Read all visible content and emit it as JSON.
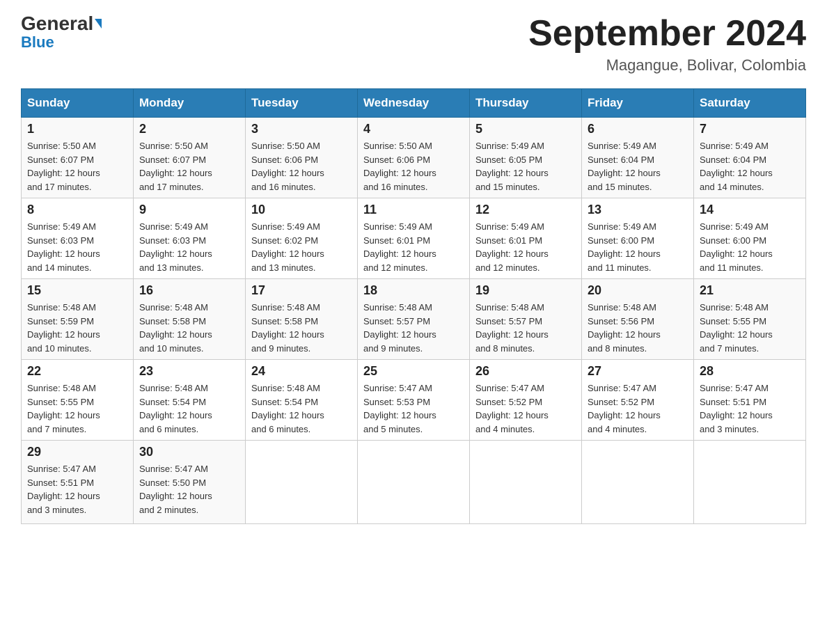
{
  "logo": {
    "text_general": "General",
    "text_blue": "Blue"
  },
  "header": {
    "title": "September 2024",
    "subtitle": "Magangue, Bolivar, Colombia"
  },
  "days_of_week": [
    "Sunday",
    "Monday",
    "Tuesday",
    "Wednesday",
    "Thursday",
    "Friday",
    "Saturday"
  ],
  "weeks": [
    [
      {
        "num": "1",
        "sunrise": "5:50 AM",
        "sunset": "6:07 PM",
        "daylight": "12 hours and 17 minutes."
      },
      {
        "num": "2",
        "sunrise": "5:50 AM",
        "sunset": "6:07 PM",
        "daylight": "12 hours and 17 minutes."
      },
      {
        "num": "3",
        "sunrise": "5:50 AM",
        "sunset": "6:06 PM",
        "daylight": "12 hours and 16 minutes."
      },
      {
        "num": "4",
        "sunrise": "5:50 AM",
        "sunset": "6:06 PM",
        "daylight": "12 hours and 16 minutes."
      },
      {
        "num": "5",
        "sunrise": "5:49 AM",
        "sunset": "6:05 PM",
        "daylight": "12 hours and 15 minutes."
      },
      {
        "num": "6",
        "sunrise": "5:49 AM",
        "sunset": "6:04 PM",
        "daylight": "12 hours and 15 minutes."
      },
      {
        "num": "7",
        "sunrise": "5:49 AM",
        "sunset": "6:04 PM",
        "daylight": "12 hours and 14 minutes."
      }
    ],
    [
      {
        "num": "8",
        "sunrise": "5:49 AM",
        "sunset": "6:03 PM",
        "daylight": "12 hours and 14 minutes."
      },
      {
        "num": "9",
        "sunrise": "5:49 AM",
        "sunset": "6:03 PM",
        "daylight": "12 hours and 13 minutes."
      },
      {
        "num": "10",
        "sunrise": "5:49 AM",
        "sunset": "6:02 PM",
        "daylight": "12 hours and 13 minutes."
      },
      {
        "num": "11",
        "sunrise": "5:49 AM",
        "sunset": "6:01 PM",
        "daylight": "12 hours and 12 minutes."
      },
      {
        "num": "12",
        "sunrise": "5:49 AM",
        "sunset": "6:01 PM",
        "daylight": "12 hours and 12 minutes."
      },
      {
        "num": "13",
        "sunrise": "5:49 AM",
        "sunset": "6:00 PM",
        "daylight": "12 hours and 11 minutes."
      },
      {
        "num": "14",
        "sunrise": "5:49 AM",
        "sunset": "6:00 PM",
        "daylight": "12 hours and 11 minutes."
      }
    ],
    [
      {
        "num": "15",
        "sunrise": "5:48 AM",
        "sunset": "5:59 PM",
        "daylight": "12 hours and 10 minutes."
      },
      {
        "num": "16",
        "sunrise": "5:48 AM",
        "sunset": "5:58 PM",
        "daylight": "12 hours and 10 minutes."
      },
      {
        "num": "17",
        "sunrise": "5:48 AM",
        "sunset": "5:58 PM",
        "daylight": "12 hours and 9 minutes."
      },
      {
        "num": "18",
        "sunrise": "5:48 AM",
        "sunset": "5:57 PM",
        "daylight": "12 hours and 9 minutes."
      },
      {
        "num": "19",
        "sunrise": "5:48 AM",
        "sunset": "5:57 PM",
        "daylight": "12 hours and 8 minutes."
      },
      {
        "num": "20",
        "sunrise": "5:48 AM",
        "sunset": "5:56 PM",
        "daylight": "12 hours and 8 minutes."
      },
      {
        "num": "21",
        "sunrise": "5:48 AM",
        "sunset": "5:55 PM",
        "daylight": "12 hours and 7 minutes."
      }
    ],
    [
      {
        "num": "22",
        "sunrise": "5:48 AM",
        "sunset": "5:55 PM",
        "daylight": "12 hours and 7 minutes."
      },
      {
        "num": "23",
        "sunrise": "5:48 AM",
        "sunset": "5:54 PM",
        "daylight": "12 hours and 6 minutes."
      },
      {
        "num": "24",
        "sunrise": "5:48 AM",
        "sunset": "5:54 PM",
        "daylight": "12 hours and 6 minutes."
      },
      {
        "num": "25",
        "sunrise": "5:47 AM",
        "sunset": "5:53 PM",
        "daylight": "12 hours and 5 minutes."
      },
      {
        "num": "26",
        "sunrise": "5:47 AM",
        "sunset": "5:52 PM",
        "daylight": "12 hours and 4 minutes."
      },
      {
        "num": "27",
        "sunrise": "5:47 AM",
        "sunset": "5:52 PM",
        "daylight": "12 hours and 4 minutes."
      },
      {
        "num": "28",
        "sunrise": "5:47 AM",
        "sunset": "5:51 PM",
        "daylight": "12 hours and 3 minutes."
      }
    ],
    [
      {
        "num": "29",
        "sunrise": "5:47 AM",
        "sunset": "5:51 PM",
        "daylight": "12 hours and 3 minutes."
      },
      {
        "num": "30",
        "sunrise": "5:47 AM",
        "sunset": "5:50 PM",
        "daylight": "12 hours and 2 minutes."
      },
      null,
      null,
      null,
      null,
      null
    ]
  ]
}
